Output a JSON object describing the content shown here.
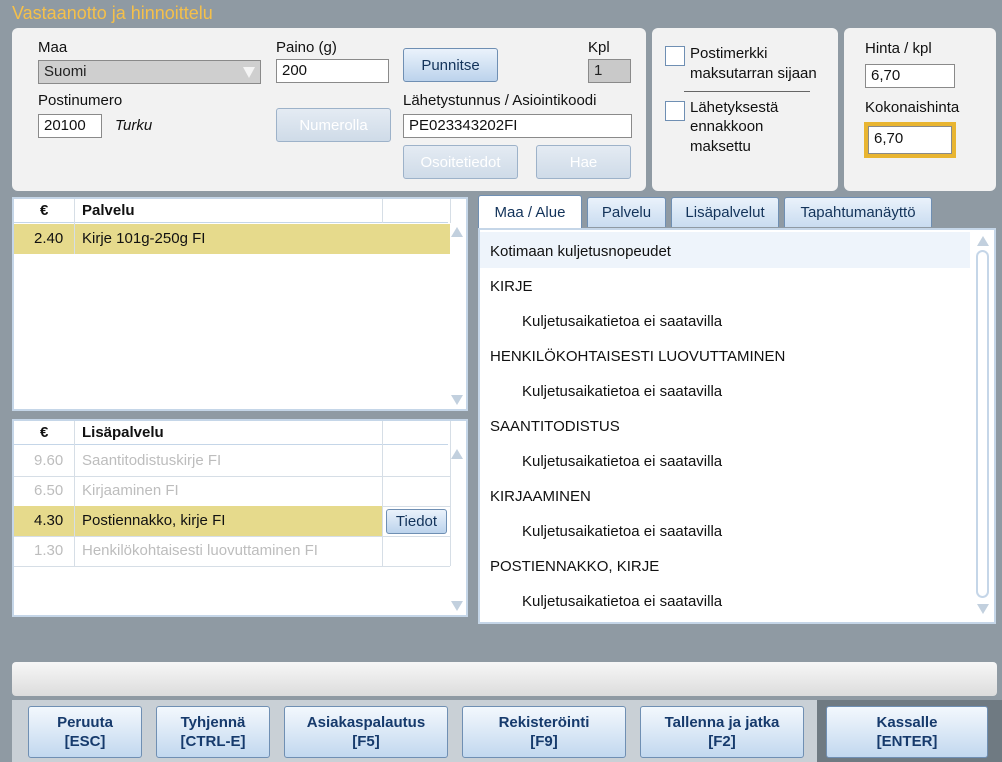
{
  "window": {
    "title": "Vastaanotto ja hinnoittelu"
  },
  "form": {
    "country_label": "Maa",
    "country_value": "Suomi",
    "weight_label": "Paino (g)",
    "weight_value": "200",
    "weigh_button": "Punnitse",
    "qty_label": "Kpl",
    "qty_value": "1",
    "postcode_label": "Postinumero",
    "postcode_value": "20100",
    "city": "Turku",
    "by_number_button": "Numerolla",
    "tracking_label": "Lähetystunnus / Asiointikoodi",
    "tracking_value": "PE023343202FI",
    "address_button": "Osoitetiedot",
    "fetch_button": "Hae"
  },
  "options": {
    "stamp_label_1": "Postimerkki",
    "stamp_label_2": "maksutarran sijaan",
    "prepaid_label_1": "Lähetyksestä",
    "prepaid_label_2": "ennakkoon",
    "prepaid_label_3": "maksettu"
  },
  "pricing": {
    "unit_label": "Hinta / kpl",
    "unit_value": "6,70",
    "total_label": "Kokonaishinta",
    "total_value": "6,70"
  },
  "services": {
    "col_price": "€",
    "col_service": "Palvelu",
    "rows": [
      {
        "price": "2.40",
        "name": "Kirje 101g-250g FI",
        "selected": true
      }
    ]
  },
  "extras": {
    "col_price": "€",
    "col_service": "Lisäpalvelu",
    "rows": [
      {
        "price": "9.60",
        "name": "Saantitodistuskirje FI",
        "enabled": false
      },
      {
        "price": "6.50",
        "name": "Kirjaaminen FI",
        "enabled": false
      },
      {
        "price": "4.30",
        "name": "Postiennakko, kirje FI",
        "enabled": true,
        "selected": true,
        "action": "Tiedot"
      },
      {
        "price": "1.30",
        "name": "Henkilökohtaisesti luovuttaminen FI",
        "enabled": false
      }
    ]
  },
  "tabs": [
    {
      "label": "Maa / Alue",
      "active": true
    },
    {
      "label": "Palvelu"
    },
    {
      "label": "Lisäpalvelut"
    },
    {
      "label": "Tapahtumanäyttö"
    }
  ],
  "info": {
    "heading": "Kotimaan kuljetusnopeudet",
    "sections": [
      {
        "title": "KIRJE",
        "detail": "Kuljetusaikatietoa ei saatavilla"
      },
      {
        "title": "HENKILÖKOHTAISESTI LUOVUTTAMINEN",
        "detail": "Kuljetusaikatietoa ei saatavilla"
      },
      {
        "title": "SAANTITODISTUS",
        "detail": "Kuljetusaikatietoa ei saatavilla"
      },
      {
        "title": "KIRJAAMINEN",
        "detail": "Kuljetusaikatietoa ei saatavilla"
      },
      {
        "title": "POSTIENNAKKO, KIRJE",
        "detail": "Kuljetusaikatietoa ei saatavilla"
      }
    ]
  },
  "footer": {
    "buttons": [
      {
        "label": "Peruuta",
        "key": "[ESC]"
      },
      {
        "label": "Tyhjennä",
        "key": "[CTRL-E]"
      },
      {
        "label": "Asiakaspalautus",
        "key": "[F5]"
      },
      {
        "label": "Rekisteröinti",
        "key": "[F9]"
      },
      {
        "label": "Tallenna ja jatka",
        "key": "[F2]"
      },
      {
        "label": "Kassalle",
        "key": "[ENTER]"
      }
    ]
  },
  "colors": {
    "title": "#f5c04a",
    "selected_row": "#e6da8c",
    "total_highlight": "#e9b531",
    "background": "#8f9aa3"
  },
  "icons": {
    "dropdown": "chevron-down-icon",
    "scroll_up": "scroll-up-arrow-icon",
    "scroll_down": "scroll-down-arrow-icon"
  }
}
